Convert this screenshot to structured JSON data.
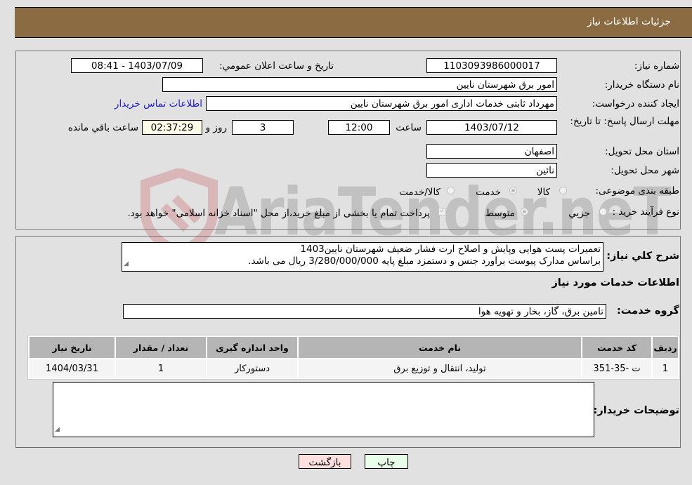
{
  "header": {
    "title": "جزئیات اطلاعات نیاز"
  },
  "form": {
    "need_number": {
      "label": "شماره نیاز:",
      "value": "1103093986000017"
    },
    "announce_datetime": {
      "label": "تاريخ و ساعت اعلان عمومي:",
      "value": "1403/07/09 - 08:41"
    },
    "buyer_org": {
      "label": "نام دستگاه خریدار:",
      "value": "امور برق شهرستان نایین"
    },
    "requester": {
      "label": "ایجاد کننده درخواست:",
      "value": "مهرداد ثابتی خدمات اداری امور برق شهرستان نایین",
      "contact_link": "اطلاعات تماس خریدار"
    },
    "deadline": {
      "label": "مهلت ارسال پاسخ: تا تاریخ:",
      "date": "1403/07/12",
      "time_label": "ساعت",
      "time": "12:00",
      "days": "3",
      "days_label": "روز و",
      "remaining": "02:37:29",
      "remaining_label": "ساعت باقي مانده"
    },
    "province": {
      "label": "استان محل تحویل:",
      "value": "اصفهان"
    },
    "city": {
      "label": "شهر محل تحویل:",
      "value": "نائین"
    },
    "category": {
      "label": "طبقه بندی موضوعی:",
      "options": [
        {
          "label": "کالا",
          "selected": false
        },
        {
          "label": "خدمت",
          "selected": true
        },
        {
          "label": "کالا/خدمت",
          "selected": false
        }
      ]
    },
    "purchase_type": {
      "label": "نوع فرآیند خرید :",
      "options": [
        {
          "label": "جزيي",
          "selected": false
        },
        {
          "label": "متوسط",
          "selected": true
        }
      ],
      "treasury_note": "پرداخت تمام یا بخشی از مبلغ خرید،از محل \"اسناد خزانه اسلامی\" خواهد بود.",
      "treasury_checked": true
    }
  },
  "description": {
    "label": "شرح كلي نياز:",
    "line1": "تعمیرات پست هوایی وپایش و اصلاح ارت فشار ضعیف شهرستان نایین1403",
    "line2": "براساس مدارک پیوست براورد جنس و دستمزد مبلغ پایه 3/280/000/000 ریال می باشد."
  },
  "services_section": {
    "title": "اطلاعات خدمات مورد نیاز",
    "group_label": "گروه خدمت:",
    "group_value": "تامین برق، گاز، بخار و تهویه هوا",
    "table": {
      "headers": [
        "ردیف",
        "کد خدمت",
        "نام خدمت",
        "واحد اندازه گیری",
        "تعداد / مقدار",
        "تاریخ نیاز"
      ],
      "rows": [
        [
          "1",
          "ت -35-351",
          "تولید، انتقال و توزیع برق",
          "دستورکار",
          "1",
          "1404/03/31"
        ]
      ]
    },
    "buyer_notes_label": "توضیحات خریدار:",
    "buyer_notes_value": ""
  },
  "buttons": {
    "print": "چاپ",
    "back": "بازگشت"
  },
  "watermark": {
    "text": "AriaTender.neT"
  },
  "colors": {
    "header_bg": "#8b6c42",
    "print_btn": "#eaffea",
    "back_btn": "#ffe0e0",
    "link": "#2020c8",
    "timer_bg": "#fffde8"
  }
}
